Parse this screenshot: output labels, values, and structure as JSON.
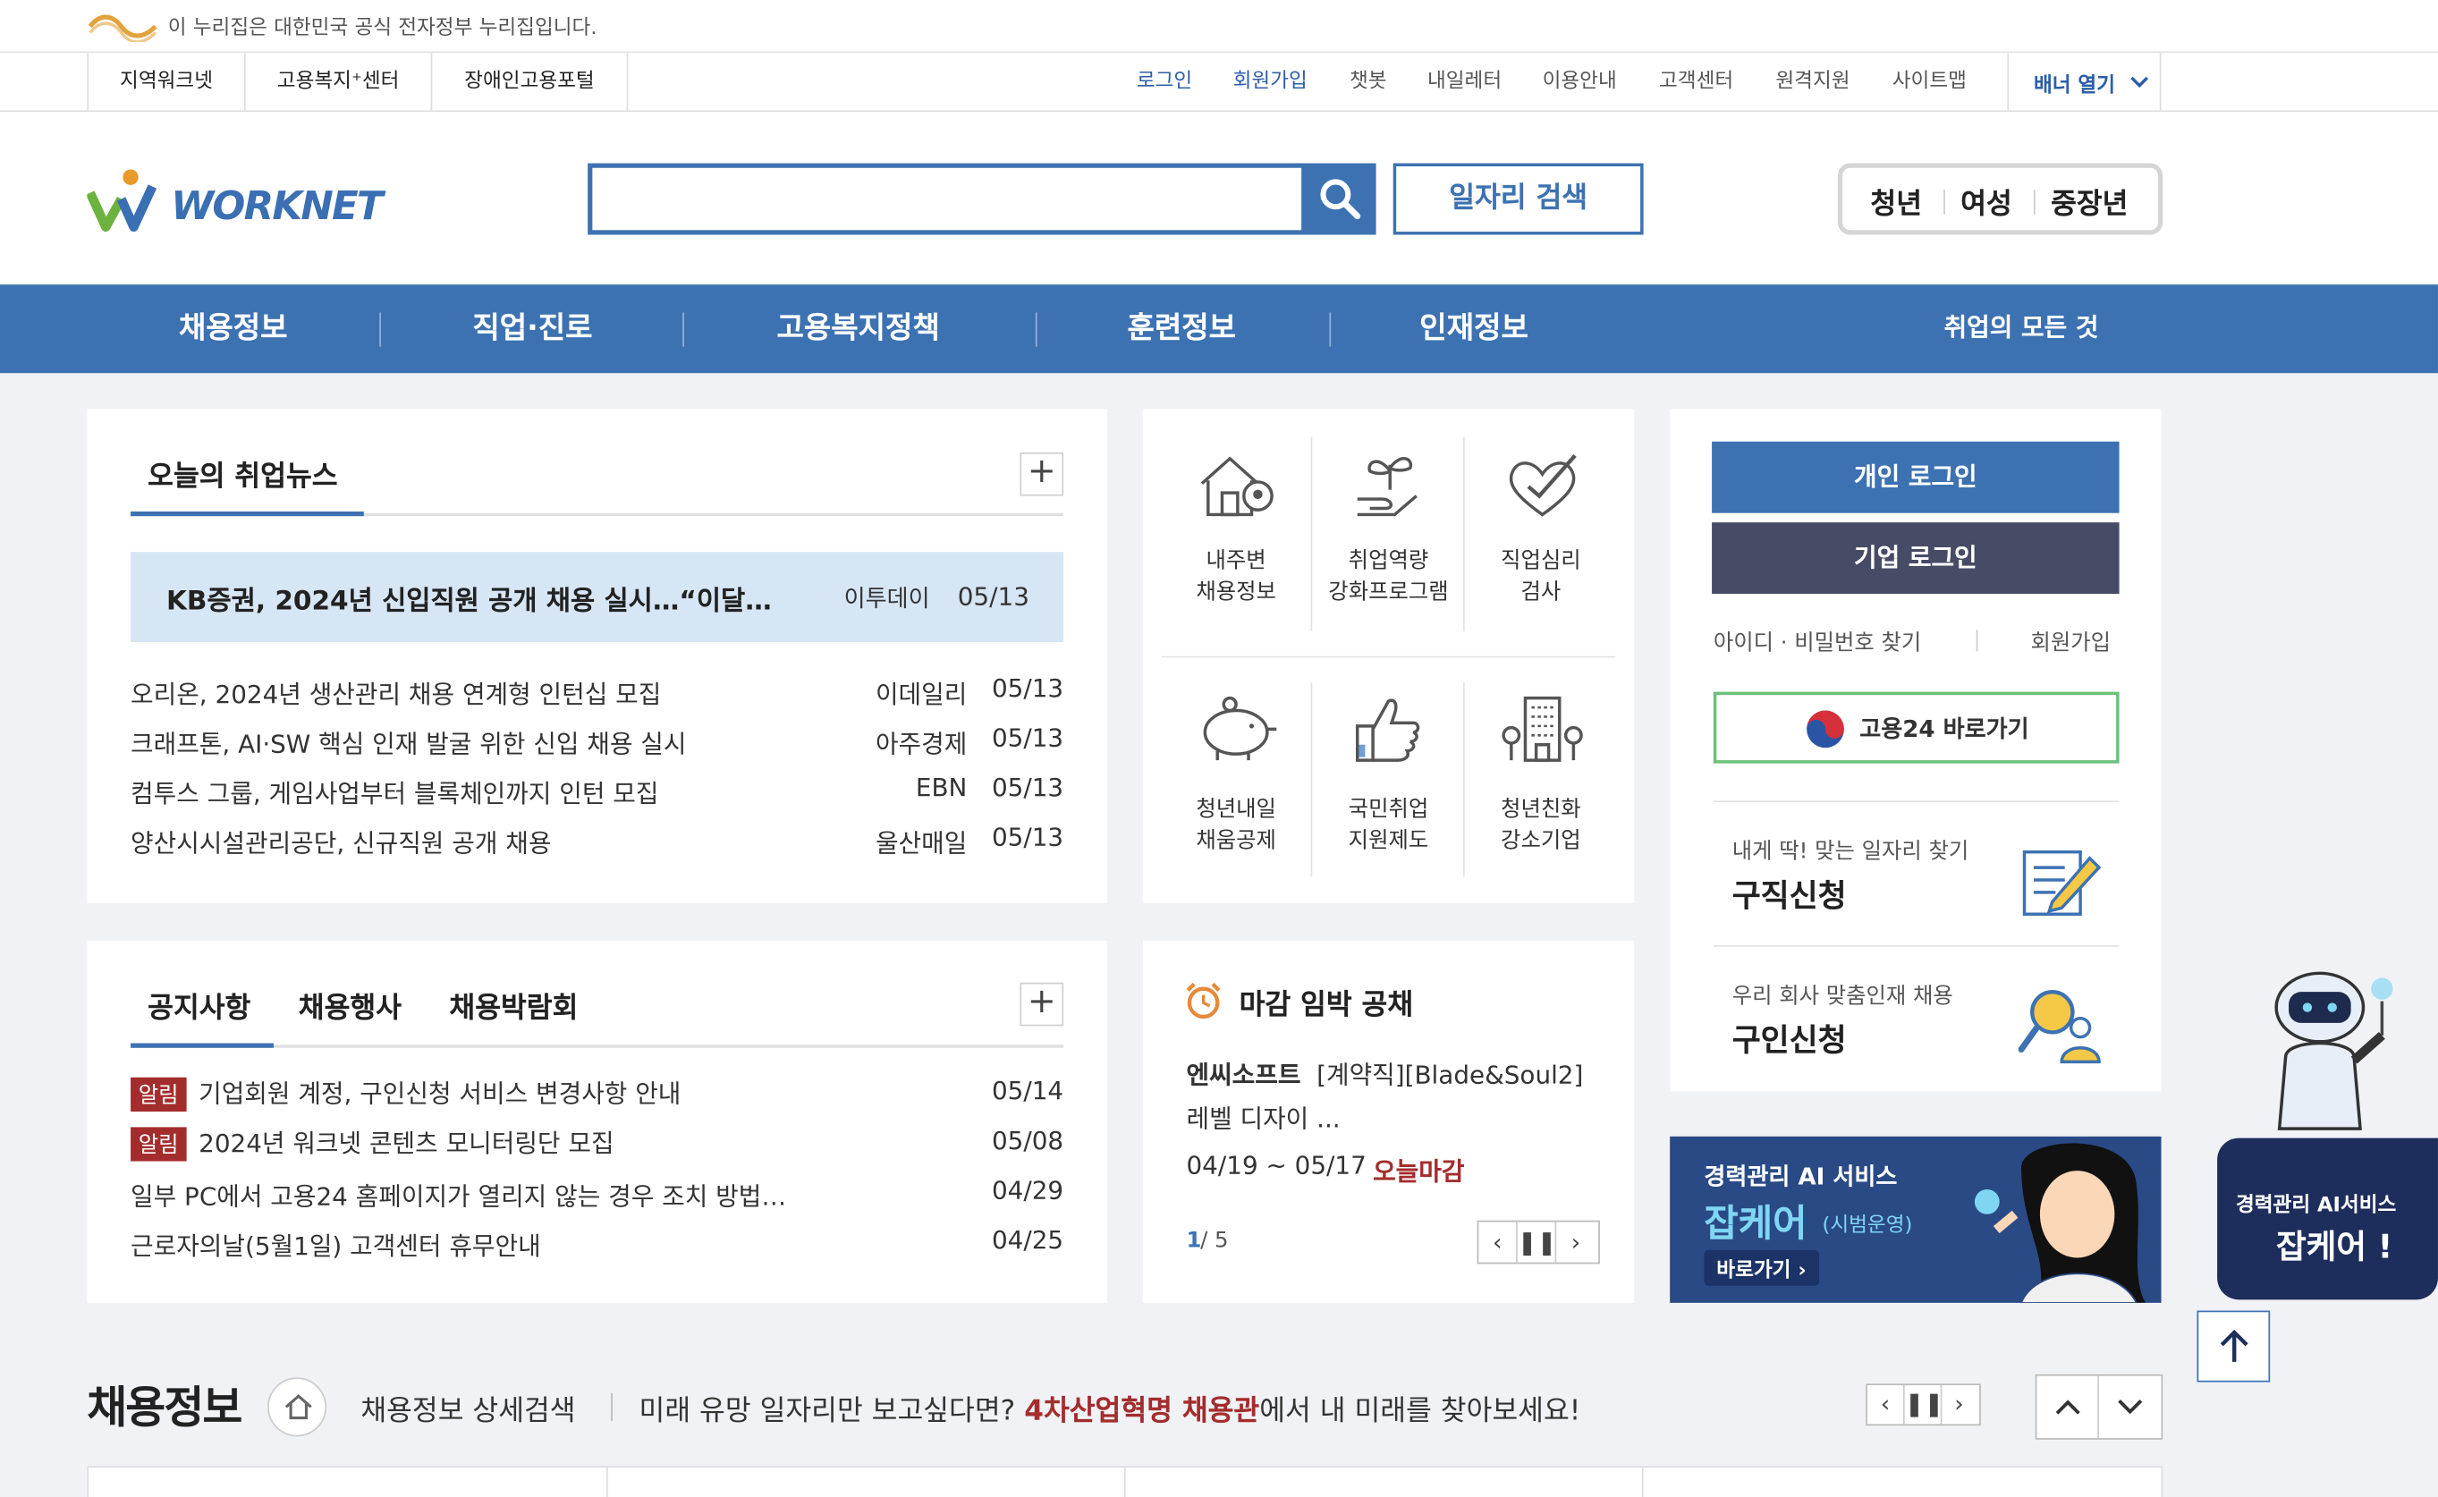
{
  "gov_banner": {
    "text": "이 누리집은 대한민국 공식 전자정부 누리집입니다."
  },
  "util": {
    "sites": [
      "지역워크넷",
      "고용복지⁺센터",
      "장애인고용포털"
    ],
    "login": "로그인",
    "join": "회원가입",
    "links": [
      "챗봇",
      "내일레터",
      "이용안내",
      "고객센터",
      "원격지원",
      "사이트맵"
    ],
    "banner_toggle": "배너 열기"
  },
  "header": {
    "logo": "WORKNET",
    "search_placeholder": "",
    "job_search_button": "일자리 검색",
    "target_groups": [
      "청년",
      "여성",
      "중장년"
    ]
  },
  "gnb": {
    "menus": [
      "채용정보",
      "직업·진로",
      "고용복지정책",
      "훈련정보",
      "인재정보"
    ],
    "right": "취업의 모든 것"
  },
  "news": {
    "tab": "오늘의 취업뉴스",
    "more": "+",
    "featured": {
      "title": "KB증권, 2024년 신입직원 공개 채용 실시…“이달…",
      "source": "이투데이",
      "date": "05/13"
    },
    "items": [
      {
        "title": "오리온, 2024년 생산관리 채용 연계형 인턴십 모집",
        "source": "이데일리",
        "date": "05/13"
      },
      {
        "title": "크래프톤, AI·SW 핵심 인재 발굴 위한 신입 채용 실시",
        "source": "아주경제",
        "date": "05/13"
      },
      {
        "title": "컴투스 그룹, 게임사업부터 블록체인까지 인턴 모집",
        "source": "EBN",
        "date": "05/13"
      },
      {
        "title": "양산시시설관리공단, 신규직원 공개 채용",
        "source": "울산매일",
        "date": "05/13"
      }
    ]
  },
  "quick": {
    "items": [
      {
        "line1": "내주변",
        "line2": "채용정보",
        "icon": "house-map-icon"
      },
      {
        "line1": "취업역량",
        "line2": "강화프로그램",
        "icon": "sprout-hand-icon"
      },
      {
        "line1": "직업심리",
        "line2": "검사",
        "icon": "heart-check-icon"
      },
      {
        "line1": "청년내일",
        "line2": "채움공제",
        "icon": "piggy-bank-icon"
      },
      {
        "line1": "국민취업",
        "line2": "지원제도",
        "icon": "thumbs-up-icon"
      },
      {
        "line1": "청년친화",
        "line2": "강소기업",
        "icon": "building-icon"
      }
    ]
  },
  "login": {
    "personal": "개인 로그인",
    "company": "기업 로그인",
    "find": "아이디 · 비밀번호 찾기",
    "join": "회원가입",
    "goyong24": "고용24 바로가기"
  },
  "services": [
    {
      "sub": "내게 딱! 맞는 일자리 찾기",
      "main": "구직신청",
      "icon": "document-pen-icon"
    },
    {
      "sub": "우리 회사 맞춤인재 채용",
      "main": "구인신청",
      "icon": "person-search-icon"
    }
  ],
  "notice": {
    "tabs": [
      "공지사항",
      "채용행사",
      "채용박람회"
    ],
    "more": "+",
    "items": [
      {
        "badge": "알림",
        "title": "기업회원 계정, 구인신청 서비스 변경사항 안내",
        "date": "05/14"
      },
      {
        "badge": "알림",
        "title": "2024년 워크넷 콘텐츠 모니터링단 모집",
        "date": "05/08"
      },
      {
        "badge": "",
        "title": "일부 PC에서 고용24 홈페이지가 열리지 않는 경우 조치 방법…",
        "date": "04/29"
      },
      {
        "badge": "",
        "title": "근로자의날(5월1일) 고객센터 휴무안내",
        "date": "04/25"
      }
    ]
  },
  "deadline": {
    "title": "마감 임박 공채",
    "company": "엔씨소프트",
    "desc1": "[계약직][Blade&Soul2]",
    "desc2": "레벨 디자이 ...",
    "period": "04/19 ~ 05/17",
    "status": "오늘마감",
    "page_current": "1",
    "page_total": "/ 5"
  },
  "banner": {
    "line1": "경력관리 AI 서비스",
    "line2": "잡케어",
    "line2_sub": "(시범운영)",
    "button": "바로가기 ›"
  },
  "floating": {
    "line1": "경력관리 AI서비스",
    "line2": "잡케어 !"
  },
  "bottom": {
    "title": "채용정보",
    "detail_search": "채용정보 상세검색",
    "promo_pre": "미래 유망 일자리만 보고싶다면? ",
    "promo_highlight": "4차산업혁명 채용관",
    "promo_post": "에서 내 미래를 찾아보세요!"
  },
  "colors": {
    "brand_blue": "#3d72b2",
    "dark_navy": "#464c66",
    "alert_red": "#a32d2d",
    "highlight_bg": "#d7e6f5"
  }
}
